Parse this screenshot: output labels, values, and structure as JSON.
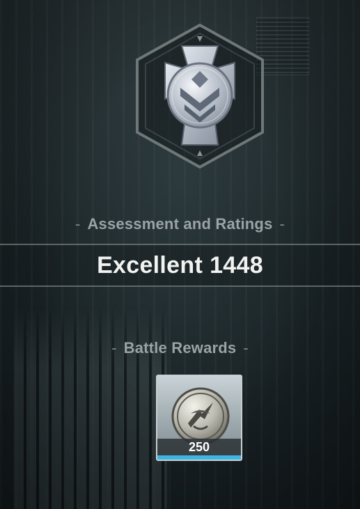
{
  "assessment": {
    "title": "Assessment and Ratings",
    "dash": "-",
    "rating_word": "Excellent",
    "rating_score": "1448"
  },
  "rewards": {
    "title": "Battle Rewards",
    "dash": "-",
    "items": [
      {
        "icon": "coin-icon",
        "quantity": "250",
        "accent_color": "#3eb6e4"
      }
    ]
  },
  "colors": {
    "badge_silver": "#c9d0d8",
    "title_text": "#9aa3a5",
    "rating_text": "#f2f2f0"
  }
}
